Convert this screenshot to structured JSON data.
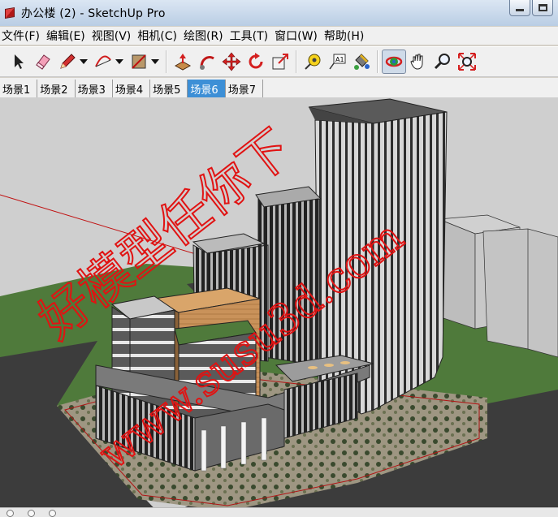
{
  "window": {
    "title": "办公楼 (2) - SketchUp Pro",
    "minimize_icon": "minimize-icon",
    "maximize_icon": "maximize-icon"
  },
  "menu": [
    {
      "label": "文件(F)"
    },
    {
      "label": "编辑(E)"
    },
    {
      "label": "视图(V)"
    },
    {
      "label": "相机(C)"
    },
    {
      "label": "绘图(R)"
    },
    {
      "label": "工具(T)"
    },
    {
      "label": "窗口(W)"
    },
    {
      "label": "帮助(H)"
    }
  ],
  "toolbar": {
    "tools": [
      {
        "icon": "select-arrow-icon"
      },
      {
        "icon": "eraser-icon"
      },
      {
        "icon": "pencil-line-icon",
        "dropdown": true
      },
      {
        "icon": "arc-icon",
        "dropdown": true
      },
      {
        "icon": "rectangle-icon",
        "dropdown": true
      },
      {
        "icon": "push-pull-icon"
      },
      {
        "icon": "follow-me-icon"
      },
      {
        "icon": "move-icon"
      },
      {
        "icon": "rotate-icon"
      },
      {
        "icon": "scale-icon"
      },
      {
        "icon": "tape-measure-icon"
      },
      {
        "icon": "text-label-icon"
      },
      {
        "icon": "paint-bucket-icon"
      },
      {
        "icon": "orbit-icon",
        "active": true
      },
      {
        "icon": "pan-hand-icon"
      },
      {
        "icon": "zoom-icon"
      },
      {
        "icon": "zoom-extents-icon"
      }
    ],
    "text_tool_label": "A1"
  },
  "scenes": {
    "tabs": [
      {
        "label": "场景1"
      },
      {
        "label": "场景2"
      },
      {
        "label": "场景3"
      },
      {
        "label": "场景4"
      },
      {
        "label": "场景5"
      },
      {
        "label": "场景6",
        "active": true
      },
      {
        "label": "场景7"
      }
    ]
  },
  "watermark": {
    "line1": "好模型任你下",
    "line2": "www.susu3d.com"
  },
  "colors": {
    "sky": "#cfcfcf",
    "ground_green": "#4f7a3b",
    "road": "#3c3c3c",
    "watermark_red": "#e11212",
    "active_scene": "#3d8fd6"
  }
}
